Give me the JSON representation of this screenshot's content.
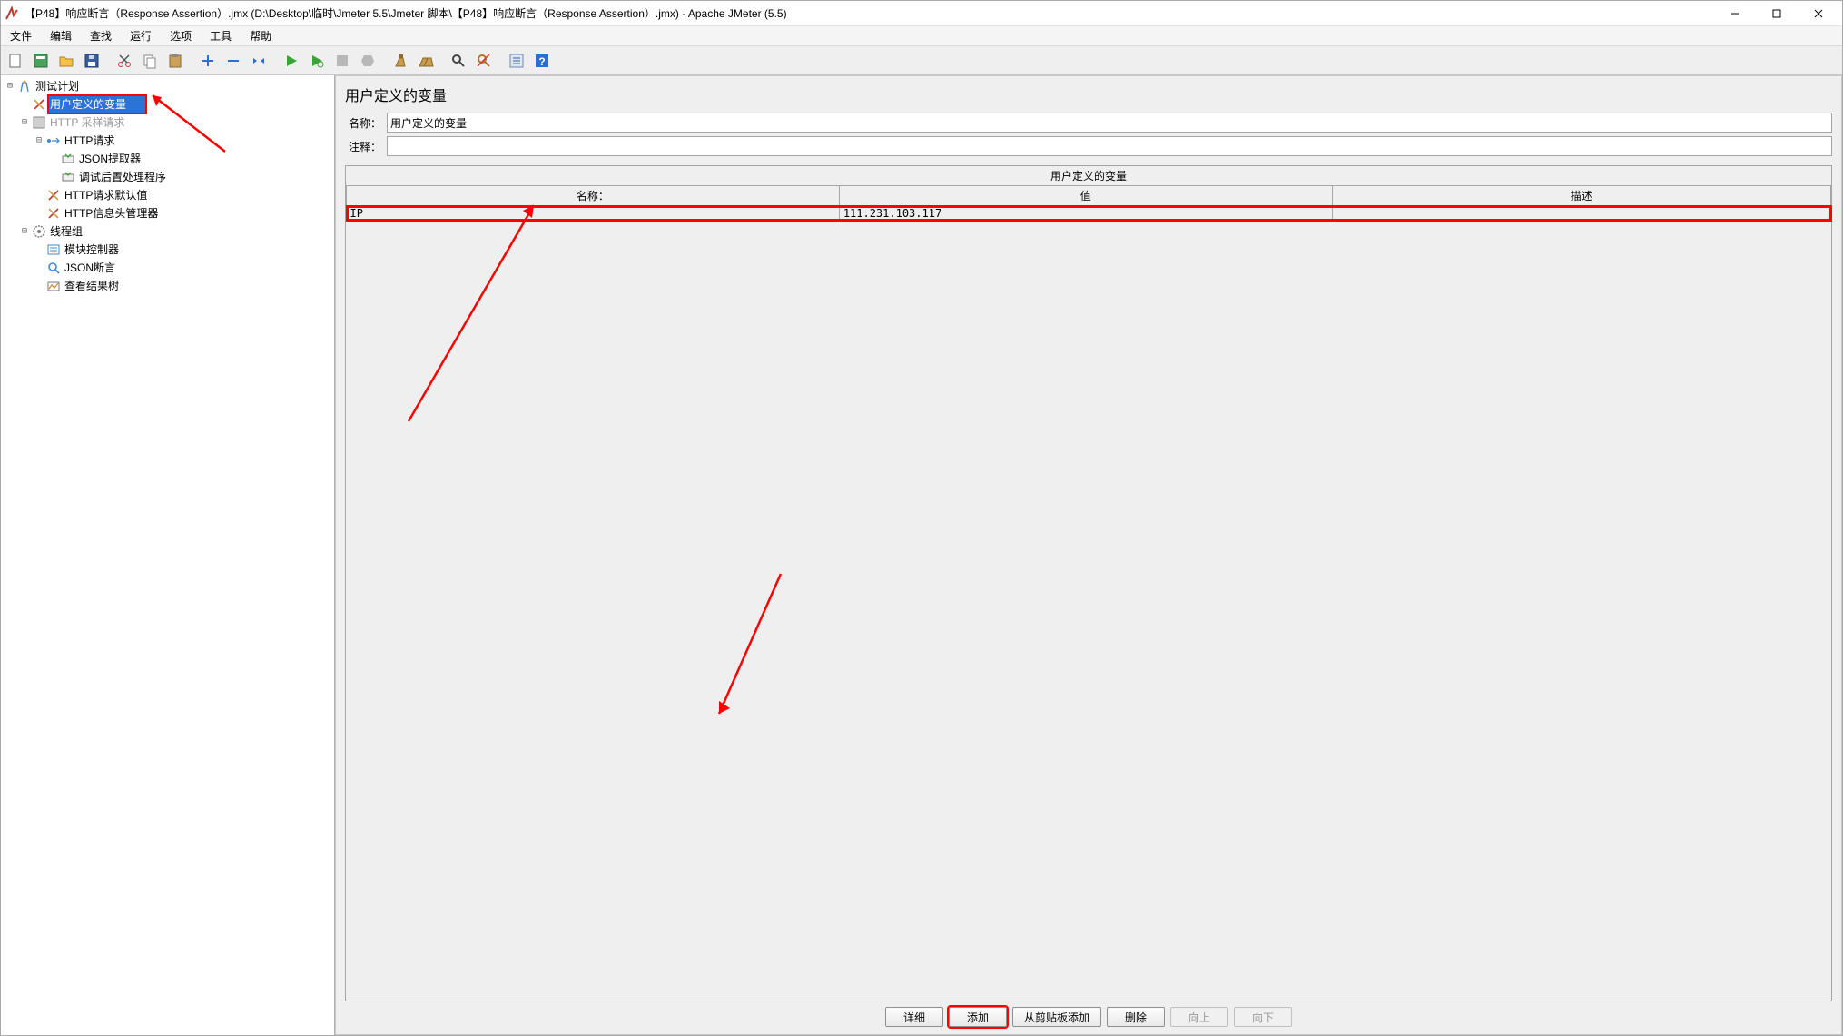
{
  "window": {
    "title": "【P48】响应断言（Response Assertion）.jmx (D:\\Desktop\\临时\\Jmeter 5.5\\Jmeter 脚本\\【P48】响应断言（Response Assertion）.jmx) - Apache JMeter (5.5)",
    "minimize_tip": "Minimize",
    "maximize_tip": "Maximize",
    "close_tip": "Close"
  },
  "menu": {
    "file": "文件",
    "edit": "编辑",
    "search": "查找",
    "run": "运行",
    "options": "选项",
    "tools": "工具",
    "help": "帮助"
  },
  "toolbar": {
    "new": "new-file-icon",
    "open_templates": "templates-icon",
    "open": "open-icon",
    "save": "save-icon",
    "cut": "cut-icon",
    "copy": "copy-icon",
    "paste": "paste-icon",
    "expand": "expand-icon",
    "collapse": "collapse-icon",
    "toggle": "toggle-icon",
    "start": "start-icon",
    "start_no_pause": "start-remote-icon",
    "stop": "stop-icon",
    "shutdown": "shutdown-icon",
    "clear": "clear-icon",
    "clear_all": "clear-all-icon",
    "search_tree": "search-icon",
    "reset_search": "reset-search-icon",
    "func_helper": "function-helper-icon",
    "help": "help-icon"
  },
  "tree": {
    "test_plan": "测试计划",
    "user_vars": "用户定义的变量",
    "http_sample": "HTTP 采样请求",
    "http_request": "HTTP请求",
    "json_extractor": "JSON提取器",
    "postprocessor": "调试后置处理程序",
    "http_defaults": "HTTP请求默认值",
    "http_header_mgr": "HTTP信息头管理器",
    "thread_group": "线程组",
    "module_controller": "模块控制器",
    "json_assertion": "JSON断言",
    "view_results": "查看结果树"
  },
  "panel": {
    "title": "用户定义的变量",
    "name_label": "名称：",
    "name_value": "用户定义的变量",
    "comment_label": "注释：",
    "comment_value": "",
    "section_title": "用户定义的变量",
    "col_name": "名称：",
    "col_value": "值",
    "col_desc": "描述",
    "rows": [
      {
        "name": "IP",
        "value": "111.231.103.117",
        "desc": ""
      }
    ],
    "buttons": {
      "detail": "详细",
      "add": "添加",
      "add_clip": "从剪贴板添加",
      "delete": "删除",
      "up": "向上",
      "down": "向下"
    }
  }
}
